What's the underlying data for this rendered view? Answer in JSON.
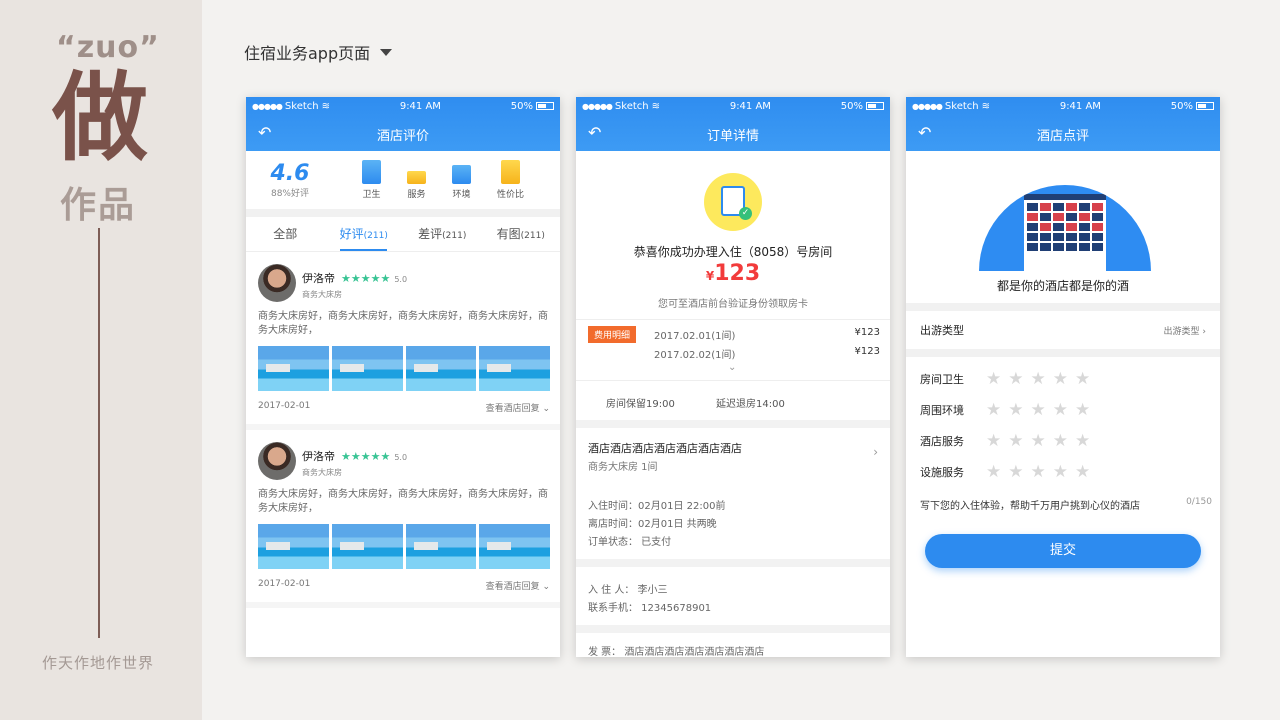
{
  "brand": {
    "zuo": "“zuo”",
    "big": "做",
    "works": "作品",
    "slogan": "作天作地作世界"
  },
  "section_title": "住宿业务app页面",
  "status": {
    "carrier": "Sketch",
    "time": "9:41 AM",
    "battery": "50%"
  },
  "phone1": {
    "title": "酒店评价",
    "score": "4.6",
    "score_pct": "88%好评",
    "categories": [
      "卫生",
      "服务",
      "环境",
      "性价比"
    ],
    "tabs": [
      {
        "label": "全部",
        "count": ""
      },
      {
        "label": "好评",
        "count": "(211)"
      },
      {
        "label": "差评",
        "count": "(211)"
      },
      {
        "label": "有图",
        "count": "(211)"
      }
    ],
    "reviews": [
      {
        "name": "伊洛帝",
        "stars": "★★★★★",
        "score": "5.0",
        "room": "商务大床房",
        "text": "商务大床房好，商务大床房好，商务大床房好，商务大床房好，商务大床房好，",
        "date": "2017-02-01",
        "reply": "查看酒店回复"
      },
      {
        "name": "伊洛帝",
        "stars": "★★★★★",
        "score": "5.0",
        "room": "商务大床房",
        "text": "商务大床房好，商务大床房好，商务大床房好，商务大床房好，商务大床房好，",
        "date": "2017-02-01",
        "reply": "查看酒店回复"
      }
    ]
  },
  "phone2": {
    "title": "订单详情",
    "success": "恭喜你成功办理入住（8058）号房间",
    "currency": "¥",
    "amount": "123",
    "note": "您可至酒店前台验证身份领取房卡",
    "fee_tag": "费用明细",
    "fees": [
      {
        "date": "2017.02.01(1间)",
        "price": "¥123"
      },
      {
        "date": "2017.02.02(1间)",
        "price": "¥123"
      }
    ],
    "keep": "房间保留19:00",
    "late": "延迟退房14:00",
    "hotel": "酒店酒店酒店酒店酒店酒店酒店",
    "room": "商务大床房  1间",
    "checkin": "入住时间：02月01日    22:00前",
    "checkout": "离店时间：02月01日    共两晚",
    "order_status": "订单状态：  已支付",
    "guest": "入 住 人：  李小三",
    "phone": "联系手机：  12345678901",
    "invoice": "发      票：  酒店酒店酒店酒店酒店酒店酒店"
  },
  "phone3": {
    "title": "酒店点评",
    "hero_text": "都是你的酒店都是你的酒",
    "trip_label": "出游类型",
    "trip_value": "出游类型",
    "ratings": [
      "房间卫生",
      "周围环境",
      "酒店服务",
      "设施服务"
    ],
    "star_glyphs": "★★★★★",
    "comment_placeholder": "写下您的入住体验，帮助千万用户挑到心仪的酒店",
    "counter": "0/150",
    "submit": "提交"
  }
}
